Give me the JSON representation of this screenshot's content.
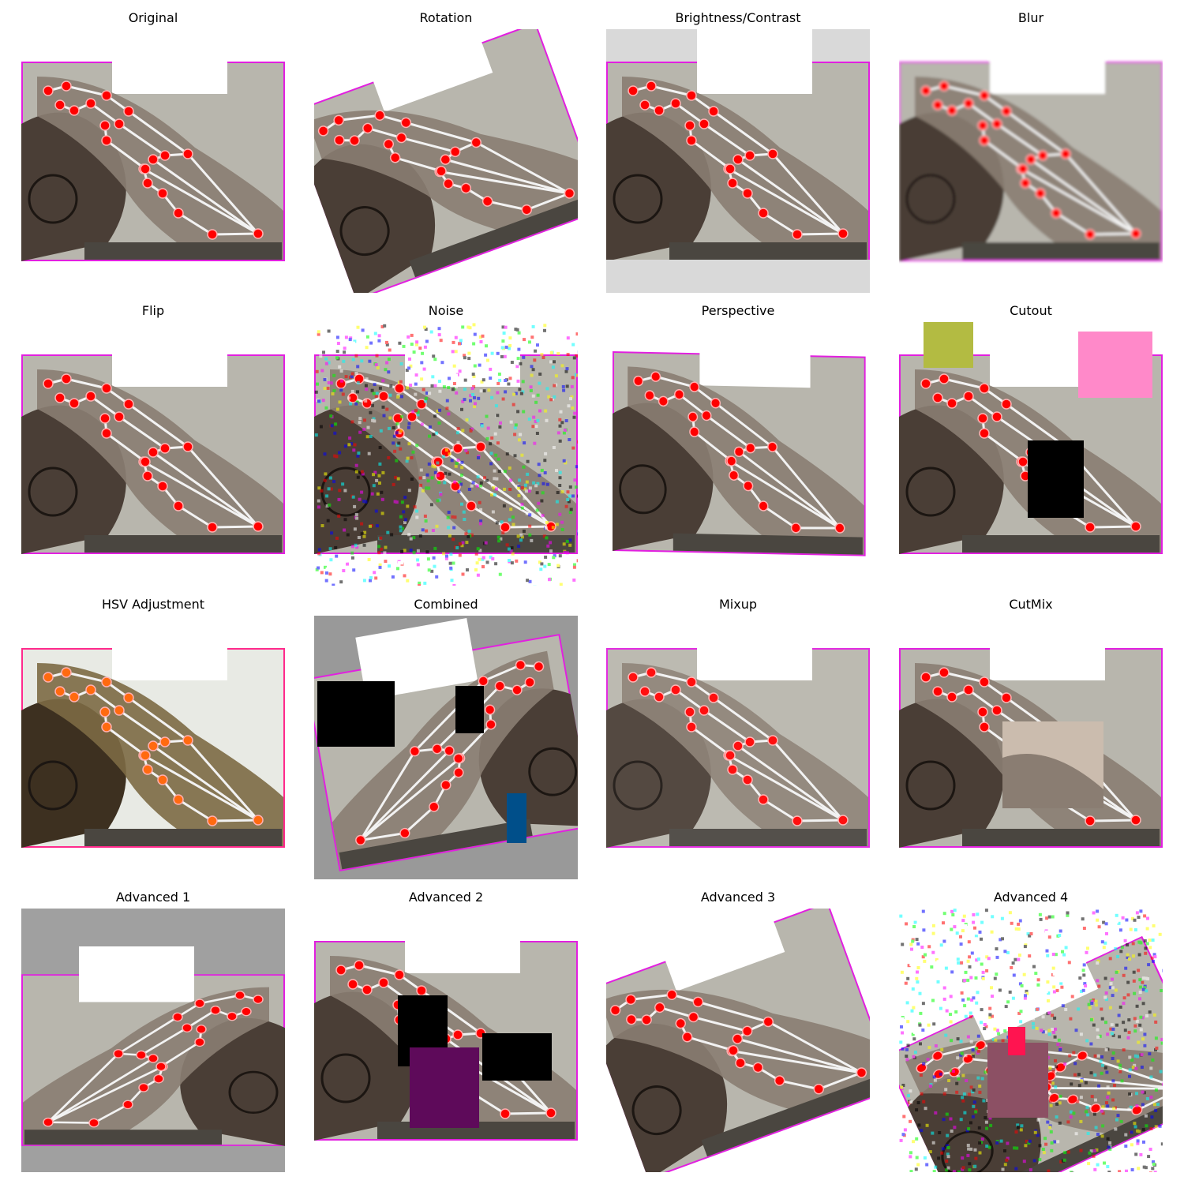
{
  "panels": [
    {
      "title": "Original",
      "variant": "original",
      "background": "#ffffff",
      "tint": "",
      "flip": false,
      "rotate": 0,
      "noise": false,
      "occluders": []
    },
    {
      "title": "Rotation",
      "variant": "rotation",
      "background": "#ffffff",
      "tint": "",
      "flip": false,
      "rotate": -20,
      "noise": false,
      "occluders": []
    },
    {
      "title": "Brightness/Contrast",
      "variant": "brightness",
      "background": "#d9d9d9",
      "tint": "",
      "flip": false,
      "rotate": 0,
      "noise": false,
      "occluders": []
    },
    {
      "title": "Blur",
      "variant": "blur",
      "background": "#ffffff",
      "tint": "",
      "flip": false,
      "rotate": 0,
      "noise": false,
      "occluders": []
    },
    {
      "title": "Flip",
      "variant": "flip",
      "background": "#ffffff",
      "tint": "",
      "flip": false,
      "rotate": 0,
      "noise": false,
      "occluders": []
    },
    {
      "title": "Noise",
      "variant": "noise",
      "background": "#ffffff",
      "tint": "",
      "flip": false,
      "rotate": 0,
      "noise": true,
      "occluders": []
    },
    {
      "title": "Perspective",
      "variant": "perspective",
      "background": "#ffffff",
      "tint": "",
      "flip": false,
      "rotate": 0,
      "noise": false,
      "occluders": []
    },
    {
      "title": "Cutout",
      "variant": "cutout",
      "background": "#ffffff",
      "tint": "",
      "flip": false,
      "rotate": 0,
      "noise": false,
      "occluders": [
        {
          "color": "#b3bb42"
        },
        {
          "color": "#ff89c9"
        },
        {
          "color": "#000000"
        }
      ]
    },
    {
      "title": "HSV Adjustment",
      "variant": "hsv",
      "background": "#ffffff",
      "tint": "hsv",
      "flip": false,
      "rotate": 0,
      "noise": false,
      "occluders": []
    },
    {
      "title": "Combined",
      "variant": "combined",
      "background": "#999999",
      "tint": "",
      "flip": true,
      "rotate": 10,
      "noise": false,
      "occluders": [
        {
          "color": "#000000"
        },
        {
          "color": "#000000"
        },
        {
          "color": "#004f8a"
        }
      ]
    },
    {
      "title": "Mixup",
      "variant": "mixup",
      "background": "#ffffff",
      "tint": "",
      "flip": false,
      "rotate": 0,
      "noise": false,
      "occluders": []
    },
    {
      "title": "CutMix",
      "variant": "cutmix",
      "background": "#ffffff",
      "tint": "",
      "flip": false,
      "rotate": 0,
      "noise": false,
      "occluders": []
    },
    {
      "title": "Advanced 1",
      "variant": "adv1",
      "background": "#a0a0a0",
      "tint": "",
      "flip": true,
      "rotate": 0,
      "noise": false,
      "occluders": []
    },
    {
      "title": "Advanced 2",
      "variant": "adv2",
      "background": "#ffffff",
      "tint": "",
      "flip": false,
      "rotate": 0,
      "noise": false,
      "occluders": [
        {
          "color": "#000000"
        },
        {
          "color": "#5e0a5a"
        },
        {
          "color": "#000000"
        }
      ]
    },
    {
      "title": "Advanced 3",
      "variant": "adv3",
      "background": "#ffffff",
      "tint": "",
      "flip": false,
      "rotate": -20,
      "noise": false,
      "occluders": []
    },
    {
      "title": "Advanced 4",
      "variant": "adv4",
      "background": "#ffffff",
      "tint": "",
      "flip": false,
      "rotate": -25,
      "noise": true,
      "occluders": [
        {
          "color": "#8c5064"
        },
        {
          "color": "#ff1450"
        }
      ]
    }
  ],
  "colors": {
    "frame": "#e21fe0",
    "keypoint": "#ff0000",
    "keypoint_hsv": "#ff6a10",
    "skeleton": "#f2f2f2",
    "wall": "#b8b6ad",
    "hand": "#8a7d72",
    "head": "#4a3e36",
    "floor": "#c9c7bf"
  }
}
